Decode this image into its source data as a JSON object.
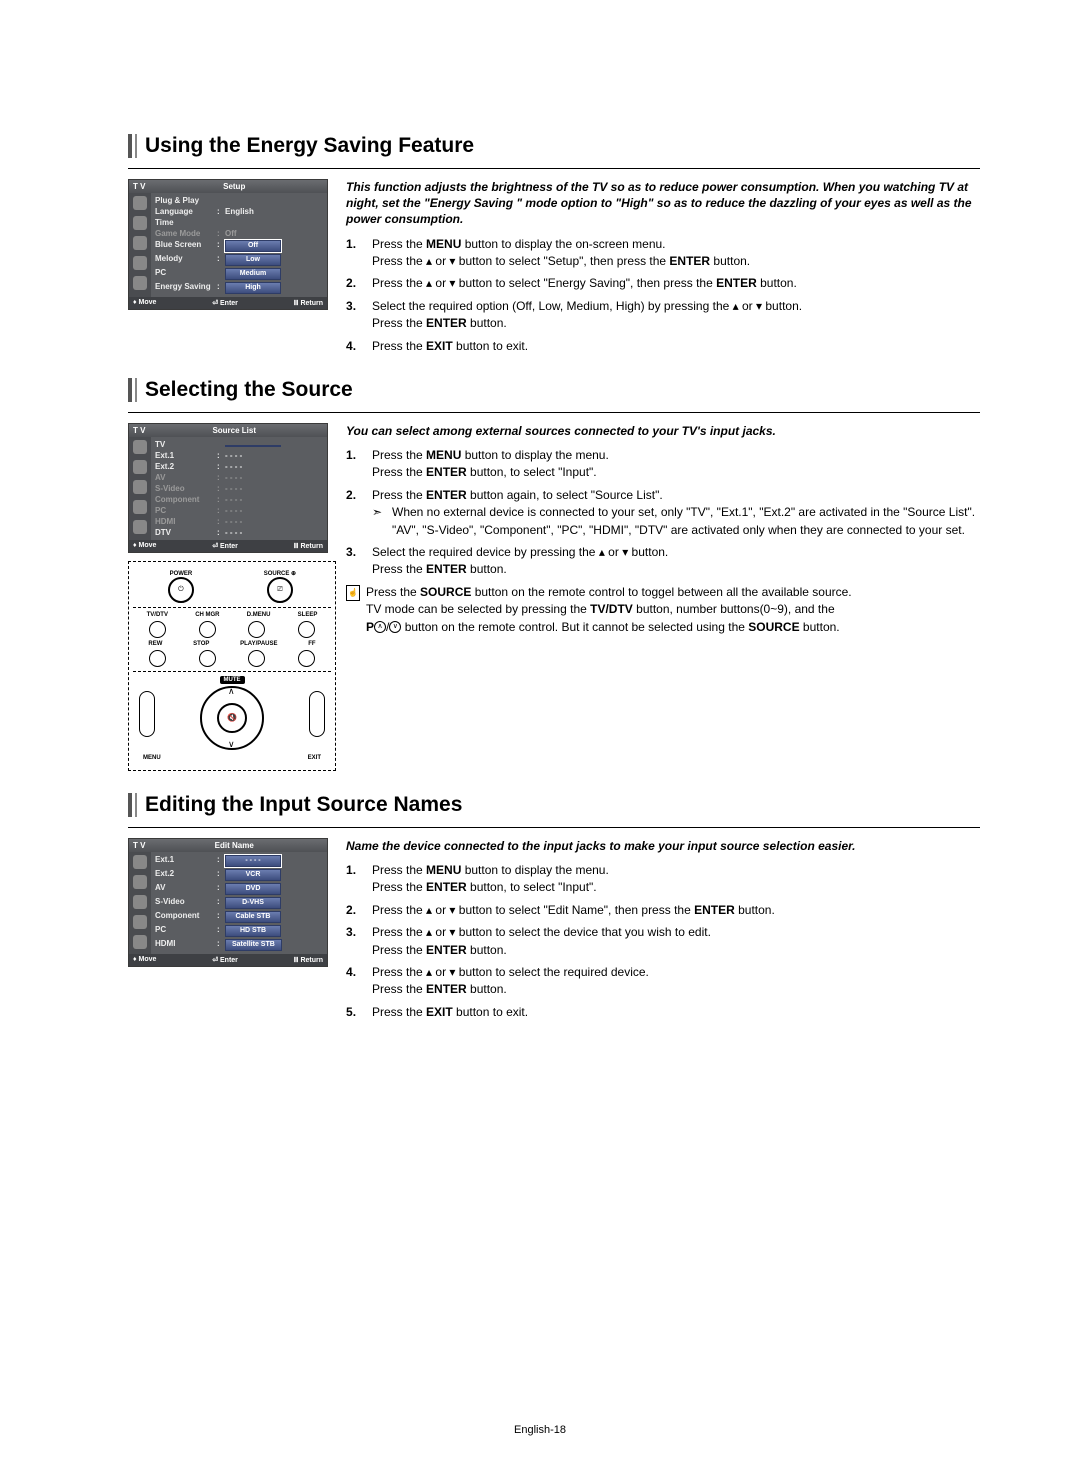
{
  "footer": "English-18",
  "section1": {
    "title": "Using the Energy Saving Feature",
    "intro": "This function adjusts the brightness of the TV so as to reduce power consumption. When you watching TV at night, set the  \"Energy Saving \" mode option to \"High\" so as to reduce the dazzling of your eyes as well as the power consumption.",
    "step1a": "Press the ",
    "step1a_bold": "MENU",
    "step1a_end": " button to display the on-screen menu.",
    "step1b_a": "Press the ",
    "step1b_mid": " or ",
    "step1b_b": " button to select \"Setup\", then press the ",
    "step1b_bold": "ENTER",
    "step1b_end": " button.",
    "step2_a": "Press the ",
    "step2_mid": " or ",
    "step2_b": " button to select \"Energy Saving\", then press the ",
    "step2_bold": "ENTER",
    "step2_end": " button.",
    "step3_a": "Select the required option (Off, Low, Medium, High) by pressing the ",
    "step3_mid": " or ",
    "step3_b": " button.",
    "step3_c": "Press the ",
    "step3_bold": "ENTER",
    "step3_end": " button.",
    "step4_a": "Press the ",
    "step4_bold": "EXIT",
    "step4_end": " button to exit.",
    "osd": {
      "tv": "T V",
      "title": "Setup",
      "rows": [
        {
          "lbl": "Plug & Play",
          "val": "",
          "dim": false
        },
        {
          "lbl": "Language",
          "val": "English",
          "dim": false,
          "colon": true
        },
        {
          "lbl": "Time",
          "val": "",
          "dim": false
        },
        {
          "lbl": "Game Mode",
          "val": "Off",
          "dim": true,
          "colon": true
        },
        {
          "lbl": "Blue Screen",
          "val": "Off",
          "dim": false,
          "colon": true,
          "box": true,
          "sel": true
        },
        {
          "lbl": "Melody",
          "val": "Low",
          "dim": false,
          "colon": true,
          "box": true
        },
        {
          "lbl": "PC",
          "val": "Medium",
          "dim": false,
          "box": true
        },
        {
          "lbl": "Energy Saving",
          "val": "High",
          "dim": false,
          "colon": true,
          "box": true
        }
      ],
      "foot": {
        "move": "Move",
        "enter": "Enter",
        "return": "Return"
      }
    }
  },
  "section2": {
    "title": "Selecting the Source",
    "intro": "You can select among external sources connected to your TV's input jacks.",
    "step1a": "Press the ",
    "step1a_bold": "MENU",
    "step1a_end": " button to display the menu.",
    "step1b_a": "Press the ",
    "step1b_bold": "ENTER",
    "step1b_end": " button, to select \"Input\".",
    "step2_a": "Press the ",
    "step2_bold": "ENTER",
    "step2_end": " button again, to select \"Source List\".",
    "step2_note": "When no external device is connected to your set, only \"TV\", \"Ext.1\", \"Ext.2\" are activated in the \"Source List\". \"AV\", \"S-Video\", \"Component\", \"PC\", \"HDMI\", \"DTV\" are activated only when they are connected to your set.",
    "step3_a": "Select the required device by pressing the ",
    "step3_mid": " or ",
    "step3_b": " button.",
    "step3_c": "Press the ",
    "step3_bold": "ENTER",
    "step3_end": " button.",
    "note1_a": "Press the ",
    "note1_bold": "SOURCE",
    "note1_b": " button on the remote control to toggel between all the available source.",
    "note2_a": "TV mode can be selected by pressing the ",
    "note2_bold": "TV/DTV",
    "note2_b": " button, number buttons(0~9), and the ",
    "note2_c": " button on the remote control. But it cannot be selected using the ",
    "note2_bold2": "SOURCE",
    "note2_end": " button.",
    "note2_p_label": "P",
    "osd": {
      "tv": "T V",
      "title": "Source List",
      "rows": [
        {
          "lbl": "TV",
          "val": "",
          "dim": false,
          "box": true
        },
        {
          "lbl": "Ext.1",
          "val": "- - - -",
          "dim": false,
          "colon": true
        },
        {
          "lbl": "Ext.2",
          "val": "- - - -",
          "dim": false,
          "colon": true
        },
        {
          "lbl": "AV",
          "val": "- - - -",
          "dim": true,
          "colon": true
        },
        {
          "lbl": "S-Video",
          "val": "- - - -",
          "dim": true,
          "colon": true
        },
        {
          "lbl": "Component",
          "val": "- - - -",
          "dim": true,
          "colon": true
        },
        {
          "lbl": "PC",
          "val": "- - - -",
          "dim": true,
          "colon": true
        },
        {
          "lbl": "HDMI",
          "val": "- - - -",
          "dim": true,
          "colon": true
        },
        {
          "lbl": "DTV",
          "val": "- - - -",
          "dim": false,
          "colon": true
        }
      ],
      "foot": {
        "move": "Move",
        "enter": "Enter",
        "return": "Return"
      }
    },
    "remote": {
      "power": "POWER",
      "source": "SOURCE",
      "r2": [
        "TV/DTV",
        "CH MGR",
        "D.MENU",
        "SLEEP"
      ],
      "r3": [
        "REW",
        "STOP",
        "PLAY/PAUSE",
        "FF"
      ],
      "mute": "MUTE",
      "menu": "MENU",
      "exit": "EXIT"
    }
  },
  "section3": {
    "title": "Editing the Input Source Names",
    "intro": "Name the device connected to the input jacks to make your input source selection easier.",
    "step1a": "Press the ",
    "step1a_bold": "MENU",
    "step1a_end": " button to display the menu.",
    "step1b_a": "Press the ",
    "step1b_bold": "ENTER",
    "step1b_end": " button, to select \"Input\".",
    "step2_a": "Press the ",
    "step2_mid": " or ",
    "step2_b": " button to select \"Edit Name\", then press the ",
    "step2_bold": "ENTER",
    "step2_end": " button.",
    "step3_a": "Press the ",
    "step3_mid": " or ",
    "step3_b": " button to select the device that you wish to edit.",
    "step3_c": "Press the ",
    "step3_bold": "ENTER",
    "step3_end": "  button.",
    "step4_a": "Press the ",
    "step4_mid": " or ",
    "step4_b": " button to select the required device.",
    "step4_c": "Press the ",
    "step4_bold": "ENTER",
    "step4_end": " button.",
    "step5_a": "Press the ",
    "step5_bold": "EXIT",
    "step5_end": " button to exit.",
    "osd": {
      "tv": "T V",
      "title": "Edit Name",
      "rows": [
        {
          "lbl": "Ext.1",
          "val": "- - - -",
          "dim": false,
          "colon": true,
          "box": true,
          "sel": true
        },
        {
          "lbl": "Ext.2",
          "val": "VCR",
          "dim": false,
          "colon": true,
          "box": true
        },
        {
          "lbl": "AV",
          "val": "DVD",
          "dim": false,
          "colon": true,
          "box": true
        },
        {
          "lbl": "S-Video",
          "val": "D-VHS",
          "dim": false,
          "colon": true,
          "box": true
        },
        {
          "lbl": "Component",
          "val": "Cable STB",
          "dim": false,
          "colon": true,
          "box": true
        },
        {
          "lbl": "PC",
          "val": "HD STB",
          "dim": false,
          "colon": true,
          "box": true
        },
        {
          "lbl": "HDMI",
          "val": "Satellite STB",
          "dim": false,
          "colon": true,
          "box": true
        }
      ],
      "foot": {
        "move": "Move",
        "enter": "Enter",
        "return": "Return"
      }
    }
  }
}
